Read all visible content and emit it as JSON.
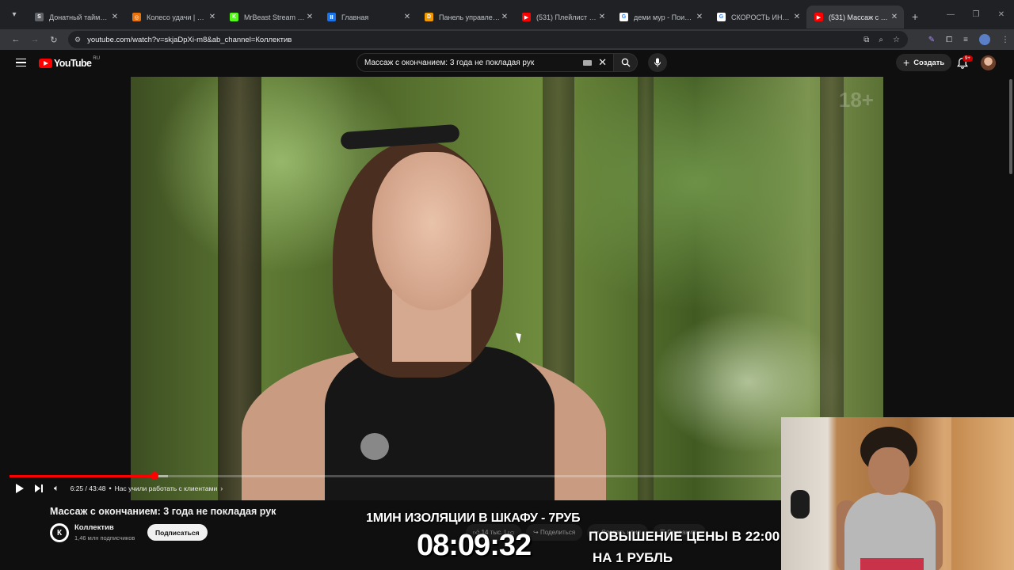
{
  "browser": {
    "tabs": [
      {
        "label": "Донатный таймер (н",
        "color": "#5f6368",
        "glyph": "S"
      },
      {
        "label": "Колесо удачи | Опр",
        "color": "#e8710a",
        "glyph": "◎"
      },
      {
        "label": "MrBeast Stream - Wa",
        "color": "#53fc18",
        "glyph": "K"
      },
      {
        "label": "Главная",
        "color": "#1a73e8",
        "glyph": "Ⅱ"
      },
      {
        "label": "Панель управления",
        "color": "#f29900",
        "glyph": "D"
      },
      {
        "label": "(531) Плейлист с но",
        "color": "#ff0000",
        "glyph": "▶"
      },
      {
        "label": "деми мур - Поиск в",
        "color": "#ffffff",
        "glyph": "G"
      },
      {
        "label": "СКОРОСТЬ ИНТЕРН",
        "color": "#ffffff",
        "glyph": "G"
      },
      {
        "label": "(531) Массаж с окон",
        "color": "#ff0000",
        "glyph": "▶"
      }
    ],
    "active_tab_index": 8,
    "url": "youtube.com/watch?v=skjaDpXi-m8&ab_channel=Коллектив"
  },
  "youtube": {
    "logo_text": "YouTube",
    "region": "RU",
    "search_query": "Массаж с окончанием: 3 года не покладая рук",
    "create_label": "Создать",
    "notif_badge": "9+"
  },
  "player": {
    "age_badge": "18+",
    "time_text": "6:25 / 43:48",
    "chapter": "Нас учили работать с клиентами",
    "progress": 0.188,
    "buffered": 0.205
  },
  "video": {
    "title": "Массаж с окончанием: 3 года не покладая рук",
    "channel_letter": "К",
    "channel_name": "Коллектив",
    "subscribers": "1,46 млн подписчиков",
    "subscribe_label": "Подписаться",
    "likes": "14 тыс.",
    "share_label": "Поделиться",
    "clip_label": "Создать клип",
    "save_label": "Сохранить"
  },
  "overlay": {
    "line1": "1МИН ИЗОЛЯЦИИ В ШКАФУ - 7РУБ",
    "timer": "08:09:32",
    "line2": "ПОВЫШЕНИЕ ЦЕНЫ В 22:00",
    "line3": "НА 1 РУБЛЬ"
  }
}
